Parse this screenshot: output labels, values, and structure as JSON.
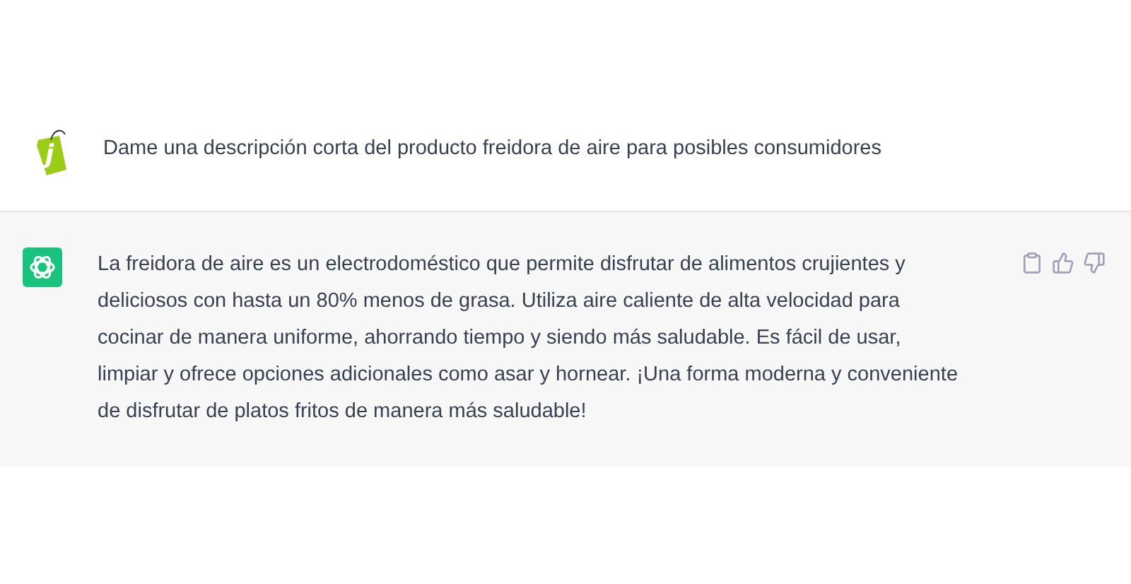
{
  "messages": [
    {
      "kind": "user",
      "avatar_letter": "j",
      "text": "Dame una descripción corta del producto freidora de aire para posibles consumidores"
    },
    {
      "kind": "assistant",
      "text": "La freidora de aire es un electrodoméstico que permite disfrutar de alimentos crujientes y deliciosos con hasta un 80% menos de grasa. Utiliza aire caliente de alta velocidad para cocinar de manera uniforme, ahorrando tiempo y siendo más saludable. Es fácil de usar, limpiar y ofrece opciones adicionales como asar y hornear. ¡Una forma moderna y conveniente de disfrutar de platos fritos de manera más saludable!"
    }
  ]
}
